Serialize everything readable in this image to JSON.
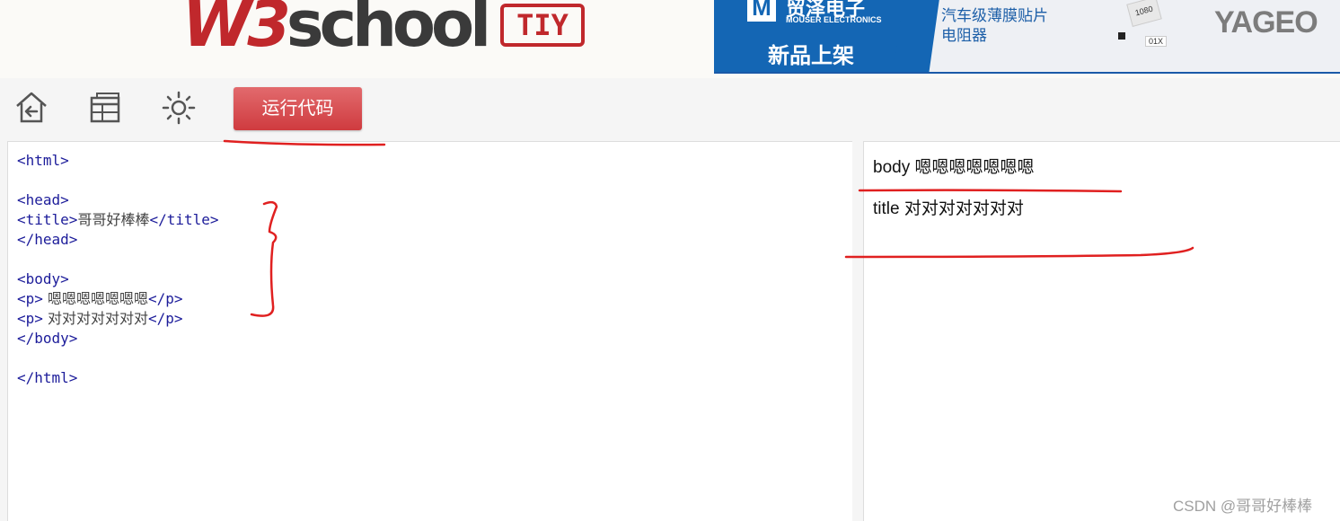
{
  "header": {
    "logo_w3": "W3",
    "logo_school": "school",
    "tiy": "TIY"
  },
  "ad": {
    "brand": "贸泽电子",
    "brand_sub": "MOUSER ELECTRONICS",
    "new_products": "新品上架",
    "line1": "汽车级薄膜贴片",
    "line2": "电阻器",
    "chip_label1": "1080",
    "chip_label2": "01X",
    "partner": "YAGEO"
  },
  "toolbar": {
    "run_label": "运行代码",
    "icons": [
      "home-back-icon",
      "layout-icon",
      "theme-sun-icon"
    ]
  },
  "editor": {
    "lines": [
      {
        "tag_open": "<html>",
        "text": "",
        "tag_close": ""
      },
      {
        "tag_open": "",
        "text": "",
        "tag_close": ""
      },
      {
        "tag_open": "<head>",
        "text": "",
        "tag_close": ""
      },
      {
        "tag_open": "<title>",
        "text": "哥哥好棒棒",
        "tag_close": "</title>"
      },
      {
        "tag_open": "</head>",
        "text": "",
        "tag_close": ""
      },
      {
        "tag_open": "",
        "text": "",
        "tag_close": ""
      },
      {
        "tag_open": "<body>",
        "text": "",
        "tag_close": ""
      },
      {
        "tag_open": "<p>",
        "text": " 嗯嗯嗯嗯嗯嗯嗯",
        "tag_close": "</p>"
      },
      {
        "tag_open": "<p>",
        "text": " 对对对对对对对",
        "tag_close": "</p>"
      },
      {
        "tag_open": "</body>",
        "text": "",
        "tag_close": ""
      },
      {
        "tag_open": "",
        "text": "",
        "tag_close": ""
      },
      {
        "tag_open": "</html>",
        "text": "",
        "tag_close": ""
      }
    ]
  },
  "preview": {
    "paragraphs": [
      "body 嗯嗯嗯嗯嗯嗯嗯",
      "title 对对对对对对对"
    ]
  },
  "watermark": "CSDN @哥哥好棒棒",
  "colors": {
    "brand_red": "#c0282c",
    "run_button": "#d94a4e",
    "tag_blue": "#1c1c9a",
    "annotation_red": "#e02020"
  }
}
